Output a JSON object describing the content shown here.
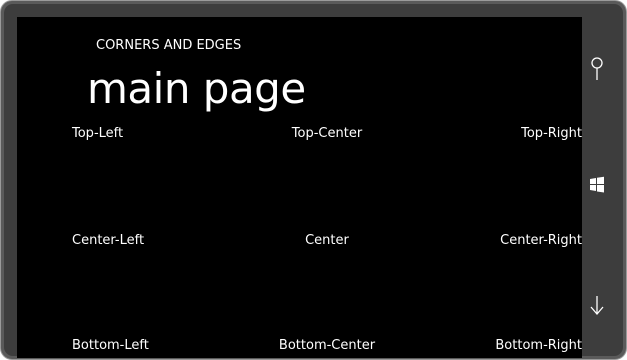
{
  "app": {
    "title": "CORNERS AND EDGES",
    "page_title": "main page"
  },
  "grid": {
    "top_left": "Top-Left",
    "top_center": "Top-Center",
    "top_right": "Top-Right",
    "center_left": "Center-Left",
    "center": "Center",
    "center_right": "Center-Right",
    "bottom_left": "Bottom-Left",
    "bottom_center": "Bottom-Center",
    "bottom_right": "Bottom-Right"
  },
  "hardware_buttons": [
    {
      "icon": "search-icon"
    },
    {
      "icon": "windows-start-icon"
    },
    {
      "icon": "back-arrow-icon"
    }
  ],
  "colors": {
    "screen_background": "#000000",
    "text": "#ffffff",
    "device_frame": "#3d3d3d"
  }
}
